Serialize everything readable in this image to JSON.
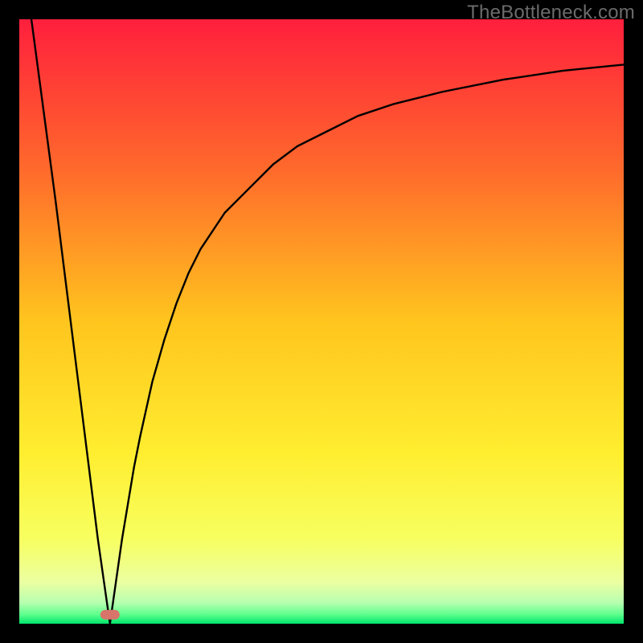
{
  "watermark": "TheBottleneck.com",
  "chart_data": {
    "type": "line",
    "title": "",
    "xlabel": "",
    "ylabel": "",
    "xlim": [
      0,
      100
    ],
    "ylim": [
      0,
      100
    ],
    "grid": false,
    "legend": false,
    "bottleneck_x": 15,
    "marker": {
      "x": 15,
      "y": 1.5,
      "color": "#d9746b"
    },
    "series": [
      {
        "name": "curve",
        "x": [
          2,
          4,
          6,
          8,
          10,
          12,
          13,
          14,
          15,
          16,
          17,
          18,
          19,
          20,
          22,
          24,
          26,
          28,
          30,
          34,
          38,
          42,
          46,
          50,
          56,
          62,
          70,
          80,
          90,
          100
        ],
        "y": [
          100,
          85,
          70,
          54,
          38,
          22,
          14,
          7,
          0,
          7,
          14,
          20,
          26,
          31,
          40,
          47,
          53,
          58,
          62,
          68,
          72,
          76,
          79,
          81,
          84,
          86,
          88,
          90,
          91.5,
          92.5
        ]
      }
    ],
    "background_gradient": {
      "stops": [
        {
          "offset": 0.0,
          "color": "#ff1f3d"
        },
        {
          "offset": 0.25,
          "color": "#ff6a2b"
        },
        {
          "offset": 0.5,
          "color": "#ffc51e"
        },
        {
          "offset": 0.72,
          "color": "#ffee30"
        },
        {
          "offset": 0.86,
          "color": "#f7ff60"
        },
        {
          "offset": 0.93,
          "color": "#ecffa0"
        },
        {
          "offset": 0.965,
          "color": "#b8ffb0"
        },
        {
          "offset": 0.985,
          "color": "#5cff8c"
        },
        {
          "offset": 1.0,
          "color": "#00e46a"
        }
      ]
    }
  }
}
